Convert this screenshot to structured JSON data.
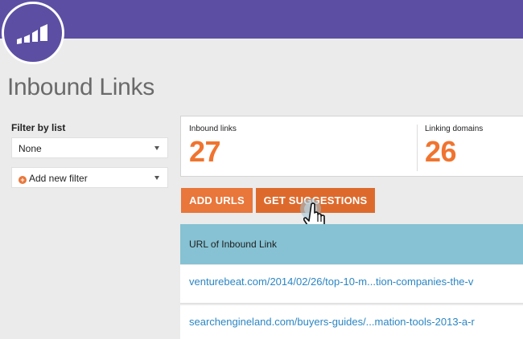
{
  "header": {
    "brand_color": "#5c4fa3",
    "logo_icon": "marketo-bars-logo-icon"
  },
  "page": {
    "title": "Inbound Links"
  },
  "filter": {
    "label": "Filter by list",
    "selected": "None",
    "add_label": "Add new filter"
  },
  "stats": {
    "inbound_label": "Inbound links",
    "inbound_value": "27",
    "domains_label": "Linking domains",
    "domains_value": "26",
    "accent_color": "#f0742f"
  },
  "actions": {
    "add_urls": "ADD URLS",
    "get_suggestions": "GET SUGGESTIONS"
  },
  "table": {
    "header": "URL of Inbound Link",
    "header_color": "#86c2d3",
    "rows": [
      "venturebeat.com/2014/02/26/top-10-m...tion-companies-the-v",
      "searchengineland.com/buyers-guides/...mation-tools-2013-a-r"
    ],
    "link_color": "#2b86c4"
  }
}
